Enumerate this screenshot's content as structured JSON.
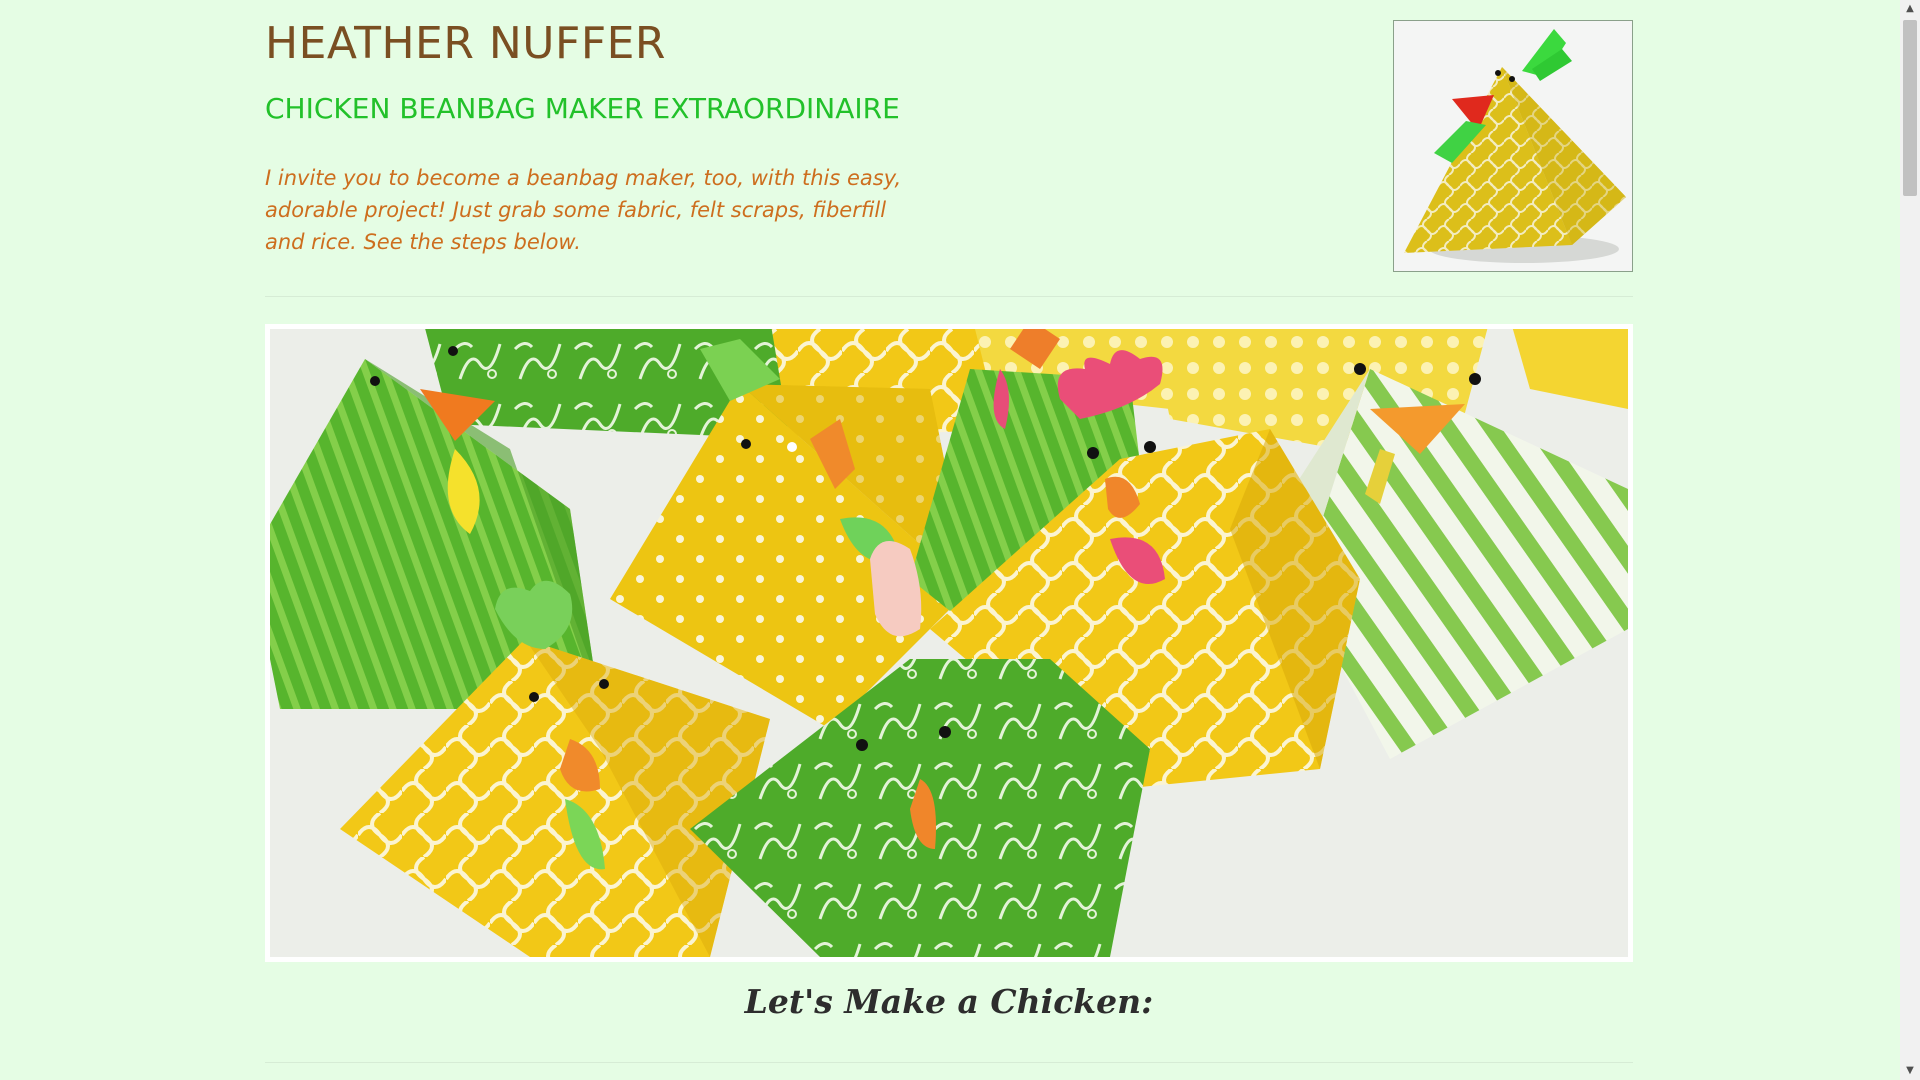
{
  "header": {
    "name": "HEATHER NUFFER",
    "tagline": "CHICKEN BEANBAG MAKER EXTRAORDINAIRE",
    "intro": "I invite you to become a beanbag maker, too, with this easy, adorable project! Just grab some fabric, felt scraps, fiberfill and rice. See the steps below."
  },
  "images": {
    "thumbnail": "single yellow chicken beanbag",
    "hero": "group of green and yellow chicken beanbags"
  },
  "section": {
    "title": "Let's Make a Chicken:"
  },
  "colors": {
    "background": "#e5fde4",
    "name": "#7a4f22",
    "tagline": "#22c12a",
    "intro": "#cd6e1e",
    "title": "#2d2d2d"
  },
  "scrollbar": {
    "up_icon": "arrow-up-icon",
    "down_icon": "arrow-down-icon"
  }
}
